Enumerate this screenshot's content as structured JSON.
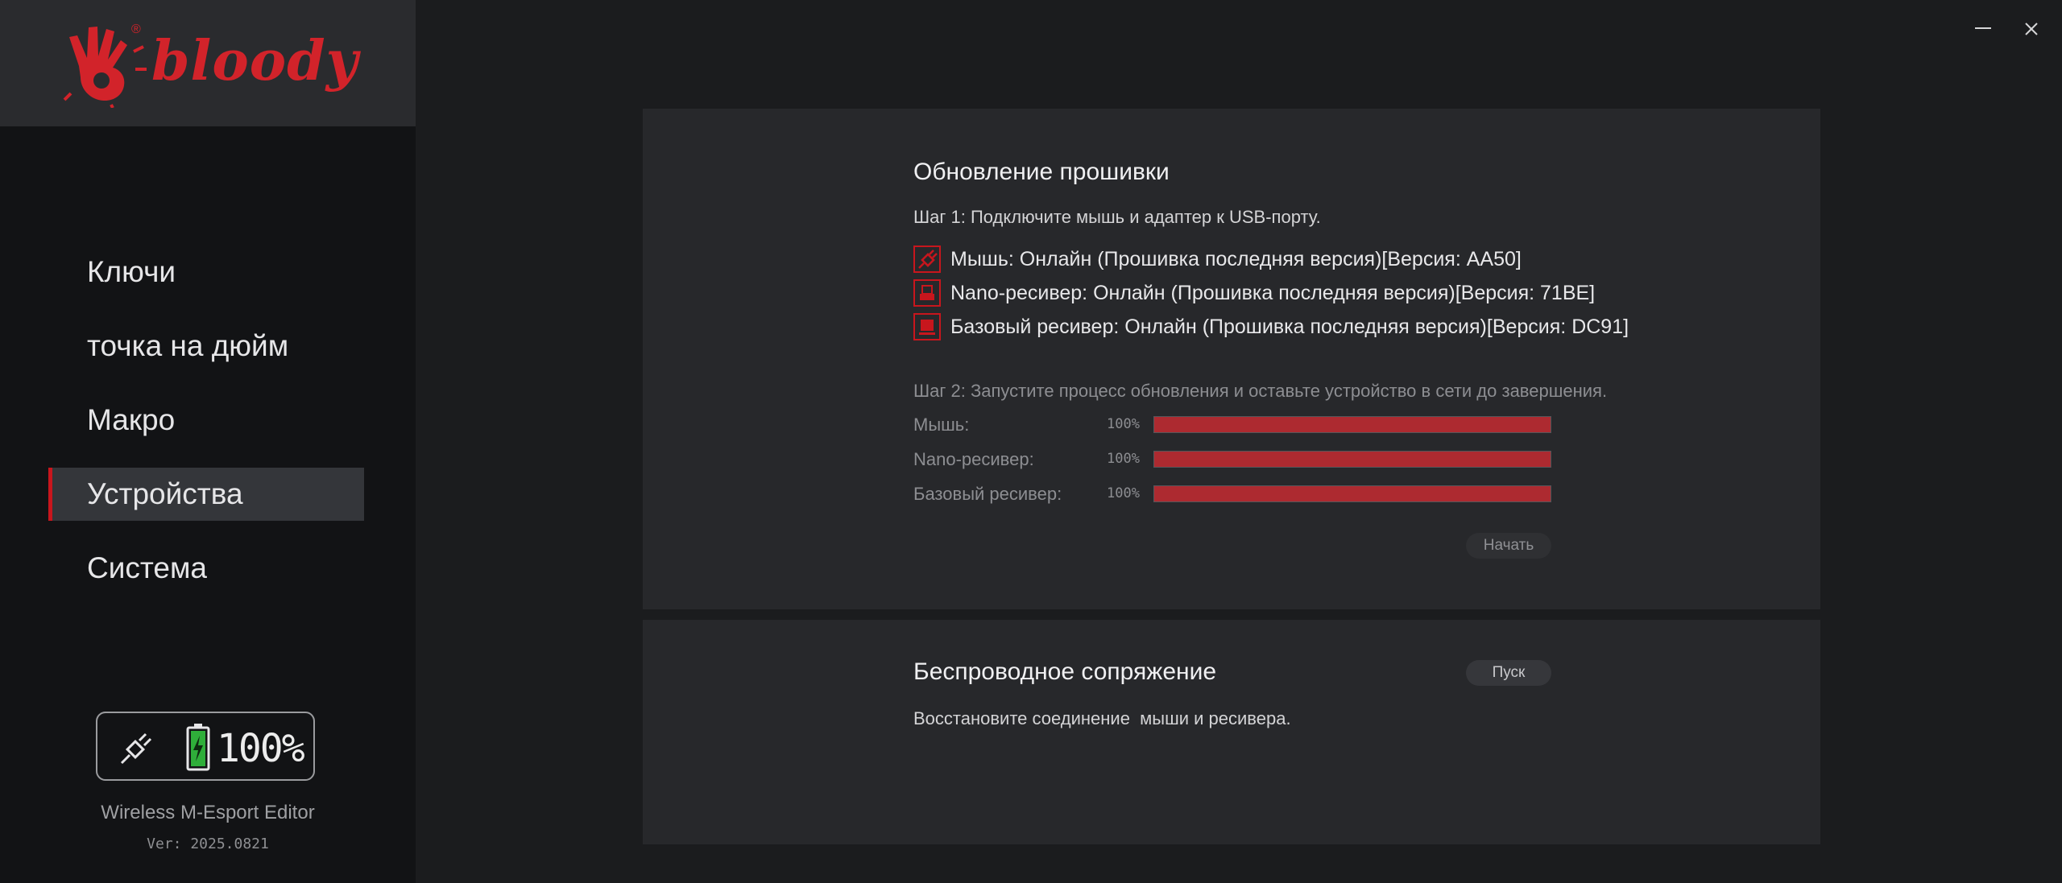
{
  "brand": {
    "name": "bloody",
    "registered": "®",
    "color": "#d2232a"
  },
  "window": {
    "minimize_icon": "minimize-icon",
    "close_icon": "close-icon"
  },
  "sidebar": {
    "items": [
      {
        "label": "Ключи",
        "active": false
      },
      {
        "label": "точка на дюйм",
        "active": false
      },
      {
        "label": "Макро",
        "active": false
      },
      {
        "label": "Устройства",
        "active": true
      },
      {
        "label": "Система",
        "active": false
      }
    ],
    "status": {
      "connection_icon": "usb-cable-icon",
      "battery_icon": "battery-charging-icon",
      "battery_pct": "100%"
    },
    "app_name": "Wireless M-Esport Editor",
    "version": "Ver: 2025.0821"
  },
  "firmware": {
    "title": "Обновление прошивки",
    "step1": "Шаг 1: Подключите мышь и адаптер к USB-порту.",
    "devices": [
      {
        "icon": "mouse-cable-icon",
        "label": "Мышь: Онлайн (Прошивка последняя версия)[Версия: AA50]"
      },
      {
        "icon": "nano-receiver-icon",
        "label": "Nano-ресивер: Онлайн (Прошивка последняя версия)[Версия: 71BE]"
      },
      {
        "icon": "base-receiver-icon",
        "label": "Базовый ресивер: Онлайн (Прошивка последняя версия)[Версия: DC91]"
      }
    ],
    "step2": "Шаг 2: Запустите процесс обновления и оставьте устройство в сети до завершения.",
    "progress": [
      {
        "label": "Мышь:",
        "pct_text": "100%",
        "value": 1.0
      },
      {
        "label": "Nano-ресивер:",
        "pct_text": "100%",
        "value": 1.0
      },
      {
        "label": "Базовый ресивер:",
        "pct_text": "100%",
        "value": 1.0
      }
    ],
    "start_button": "Начать",
    "progress_color": "#ad2a30"
  },
  "wireless": {
    "title": "Беспроводное сопряжение",
    "description": "Восстановите соединение  мыши и ресивера.",
    "go_button": "Пуск"
  }
}
